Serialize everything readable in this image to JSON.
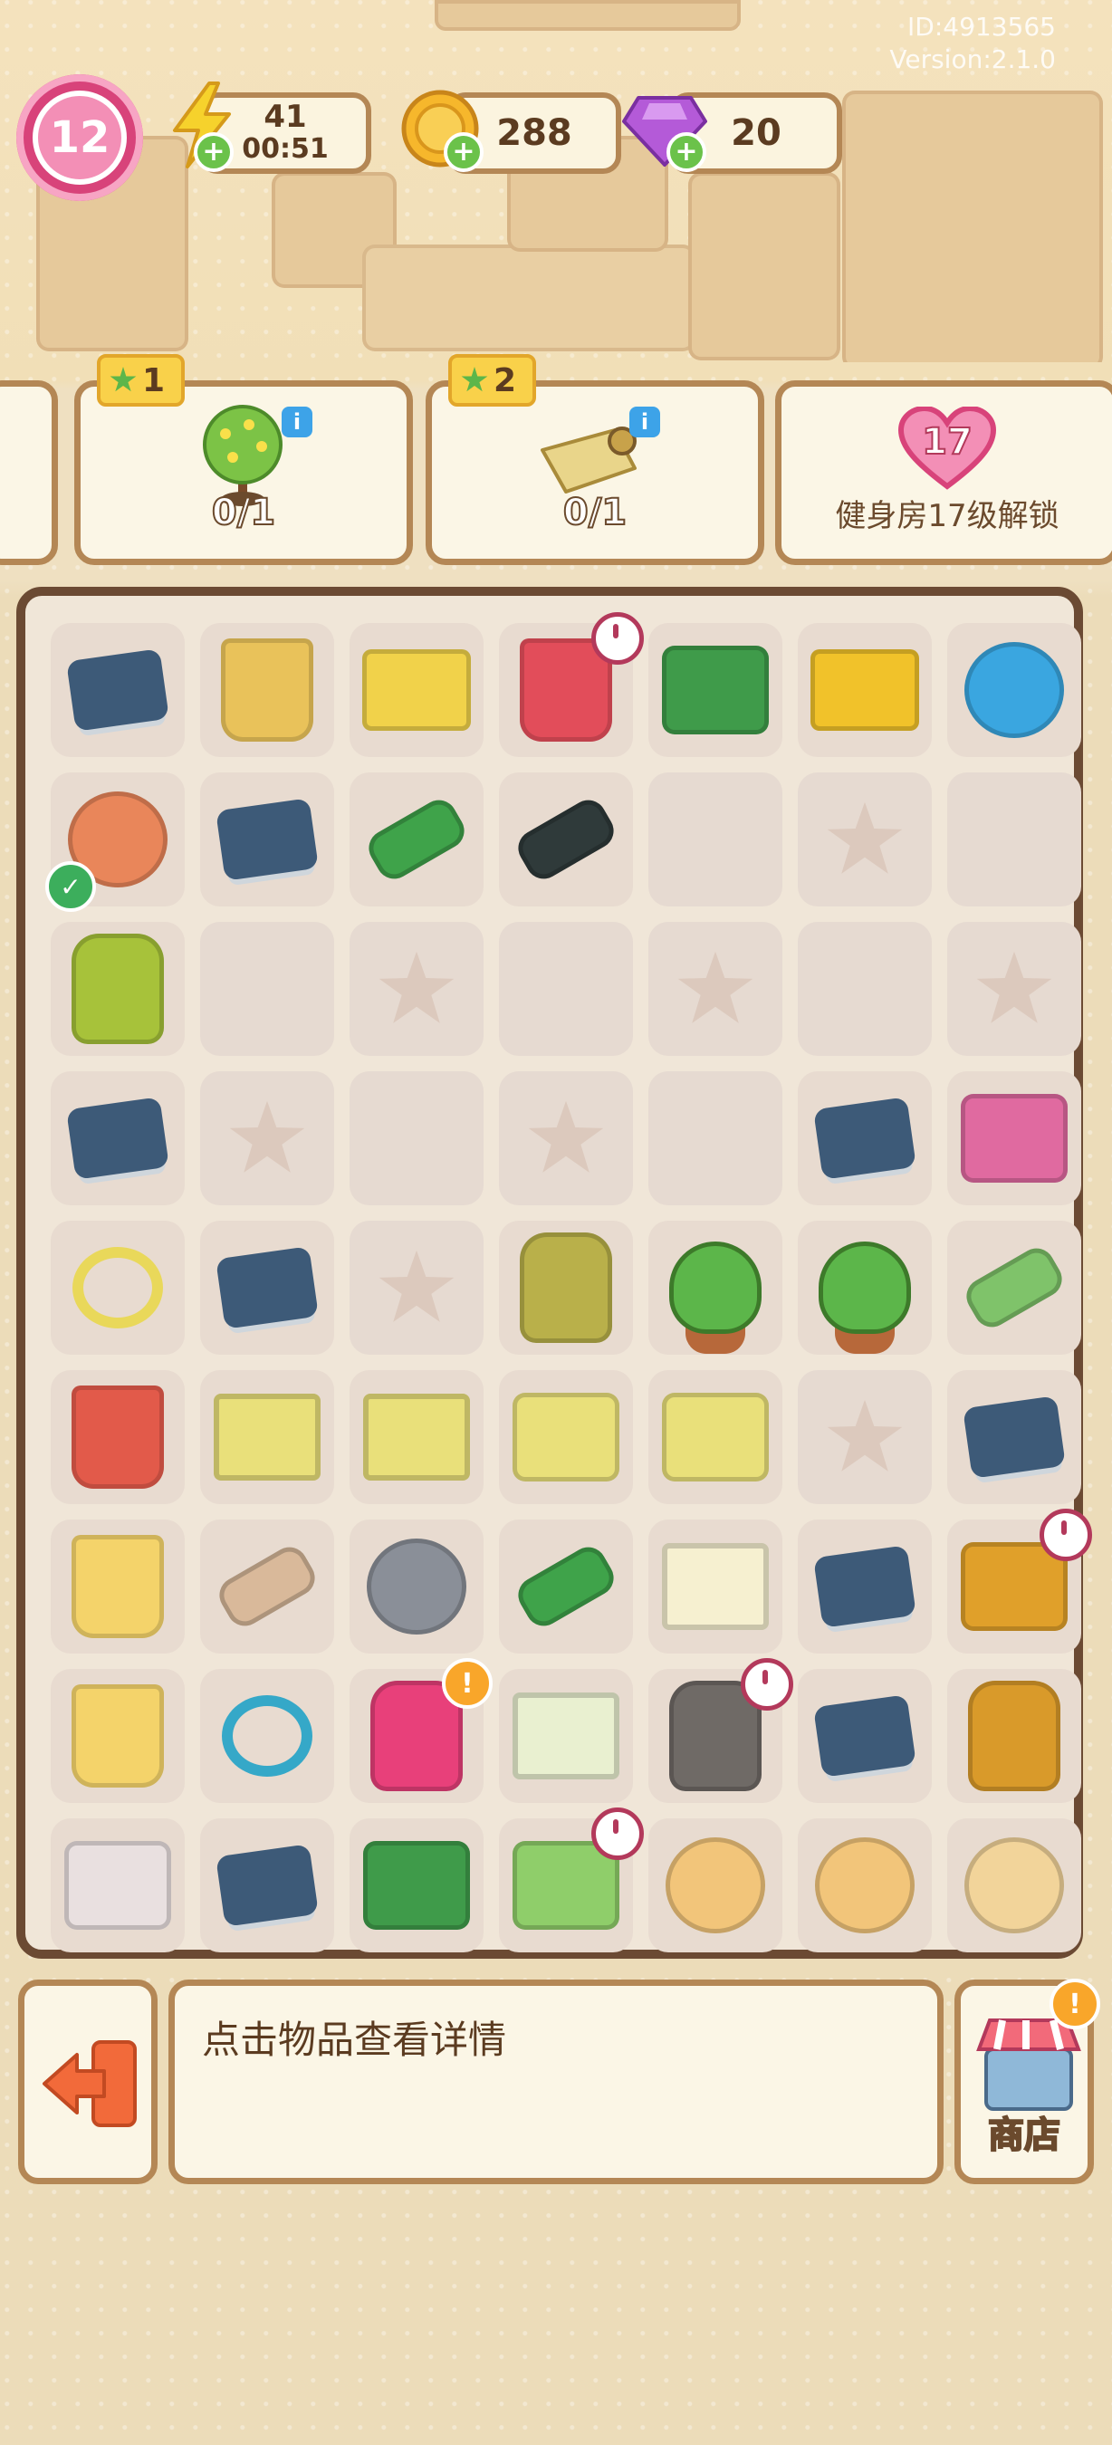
{
  "header": {
    "id_text": "ID:4913565",
    "version_text": "Version:2.1.0",
    "level": "12",
    "energy": {
      "value": "41",
      "timer": "00:51",
      "icon": "lightning-icon"
    },
    "coins": {
      "value": "288",
      "icon": "coin-icon"
    },
    "gems": {
      "value": "20",
      "icon": "gem-icon"
    }
  },
  "tasks": [
    {
      "stars": "1",
      "progress": "0/1",
      "icon": "flower-bush-icon"
    },
    {
      "stars": "2",
      "progress": "0/1",
      "icon": "paper-roll-icon"
    },
    {
      "level": "17",
      "lock_text": "健身房17级解锁",
      "icon": "heart-level-icon"
    }
  ],
  "board": {
    "rows": [
      [
        {
          "icon": "chip-web-icon"
        },
        {
          "icon": "bucket-icon"
        },
        {
          "icon": "cart-tools-icon"
        },
        {
          "icon": "red-bucket-icon",
          "timer": true
        },
        {
          "icon": "green-toolbox-icon"
        },
        {
          "icon": "yellow-cart-icon"
        },
        {
          "icon": "robot-vacuum-icon"
        }
      ],
      [
        {
          "icon": "measuring-tape-icon",
          "check": true
        },
        {
          "icon": "chip-web-icon"
        },
        {
          "icon": "drill-icon"
        },
        {
          "icon": "wrench-icon"
        },
        {
          "icon": "empty"
        },
        {
          "icon": "star"
        },
        {
          "icon": "empty"
        }
      ],
      [
        {
          "icon": "seed-bag-icon"
        },
        {
          "icon": "empty"
        },
        {
          "icon": "star"
        },
        {
          "icon": "empty"
        },
        {
          "icon": "star"
        },
        {
          "icon": "empty"
        },
        {
          "icon": "star"
        }
      ],
      [
        {
          "icon": "chip-web-icon"
        },
        {
          "icon": "star"
        },
        {
          "icon": "empty"
        },
        {
          "icon": "star"
        },
        {
          "icon": "empty"
        },
        {
          "icon": "chip-web-icon"
        },
        {
          "icon": "pink-bricks-icon"
        }
      ],
      [
        {
          "icon": "jump-rope-icon"
        },
        {
          "icon": "chip-web-icon"
        },
        {
          "icon": "star"
        },
        {
          "icon": "seed-bags-icon"
        },
        {
          "icon": "sprout-pot-icon"
        },
        {
          "icon": "tree-pot-icon"
        },
        {
          "icon": "glove-icon"
        }
      ],
      [
        {
          "icon": "paint-can-icon"
        },
        {
          "icon": "frame-icon"
        },
        {
          "icon": "basket-frame-icon"
        },
        {
          "icon": "basket-icon"
        },
        {
          "icon": "basket-weight-icon"
        },
        {
          "icon": "star"
        },
        {
          "icon": "circuit-web-icon"
        }
      ],
      [
        {
          "icon": "paint-bucket-icon"
        },
        {
          "icon": "pipe-icon"
        },
        {
          "icon": "shell-icon"
        },
        {
          "icon": "megaphone-icon"
        },
        {
          "icon": "chart-note-icon"
        },
        {
          "icon": "circuit-web-icon"
        },
        {
          "icon": "cabinet-icon",
          "timer": true
        }
      ],
      [
        {
          "icon": "paint-bucket-icon"
        },
        {
          "icon": "hoop-icon"
        },
        {
          "icon": "backpack-icon",
          "alert": true
        },
        {
          "icon": "magazine-icon"
        },
        {
          "icon": "trash-bag-icon",
          "timer": true
        },
        {
          "icon": "chip-web-icon"
        },
        {
          "icon": "paper-bag-icon"
        }
      ],
      [
        {
          "icon": "toolbox-icon"
        },
        {
          "icon": "chip-web-icon"
        },
        {
          "icon": "green-box-icon"
        },
        {
          "icon": "tv-icon",
          "timer": true
        },
        {
          "icon": "hamster-group-icon"
        },
        {
          "icon": "hamster-icon"
        },
        {
          "icon": "small-hamster-icon"
        }
      ]
    ]
  },
  "footer": {
    "hint_text": "点击物品查看详情",
    "exit_icon": "exit-icon",
    "shop_label": "商店",
    "shop_icon": "shop-icon"
  },
  "colors": {
    "border_brown": "#b48755",
    "board_border": "#6b4a33",
    "level_pink": "#d8437a",
    "energy_yellow": "#f6d22c",
    "gem_purple": "#a94fd6"
  }
}
